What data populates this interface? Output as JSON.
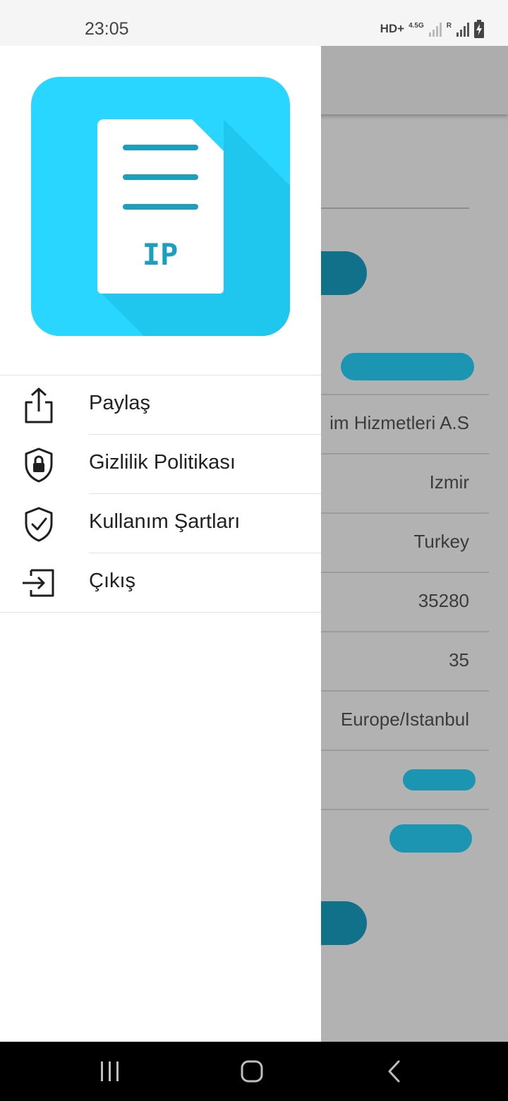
{
  "status_bar": {
    "time": "23:05",
    "network_label": "HD+",
    "network_type": "4.5G",
    "roaming": "R",
    "icons": [
      "signal-icon",
      "roaming-signal-icon",
      "battery-charging-icon"
    ]
  },
  "background_screen": {
    "rows": [
      {
        "value": "im Hizmetleri A.S"
      },
      {
        "value": "Izmir"
      },
      {
        "value": "Turkey"
      },
      {
        "value": "35280"
      },
      {
        "value": "35"
      },
      {
        "value": "Europe/Istanbul"
      }
    ],
    "colors": {
      "button": "#1aa3c6",
      "pill": "#29d6ff"
    }
  },
  "drawer": {
    "logo": {
      "text": "IP",
      "background": "#29d6ff",
      "accent": "#1a9fc0"
    },
    "menu": [
      {
        "label": "Paylaş",
        "icon": "share-icon"
      },
      {
        "label": "Gizlilik Politikası",
        "icon": "privacy-shield-lock-icon"
      },
      {
        "label": "Kullanım Şartları",
        "icon": "shield-check-icon"
      },
      {
        "label": "Çıkış",
        "icon": "exit-icon"
      }
    ]
  },
  "nav_bar": {
    "buttons": [
      "recents-icon",
      "home-icon",
      "back-icon"
    ]
  }
}
